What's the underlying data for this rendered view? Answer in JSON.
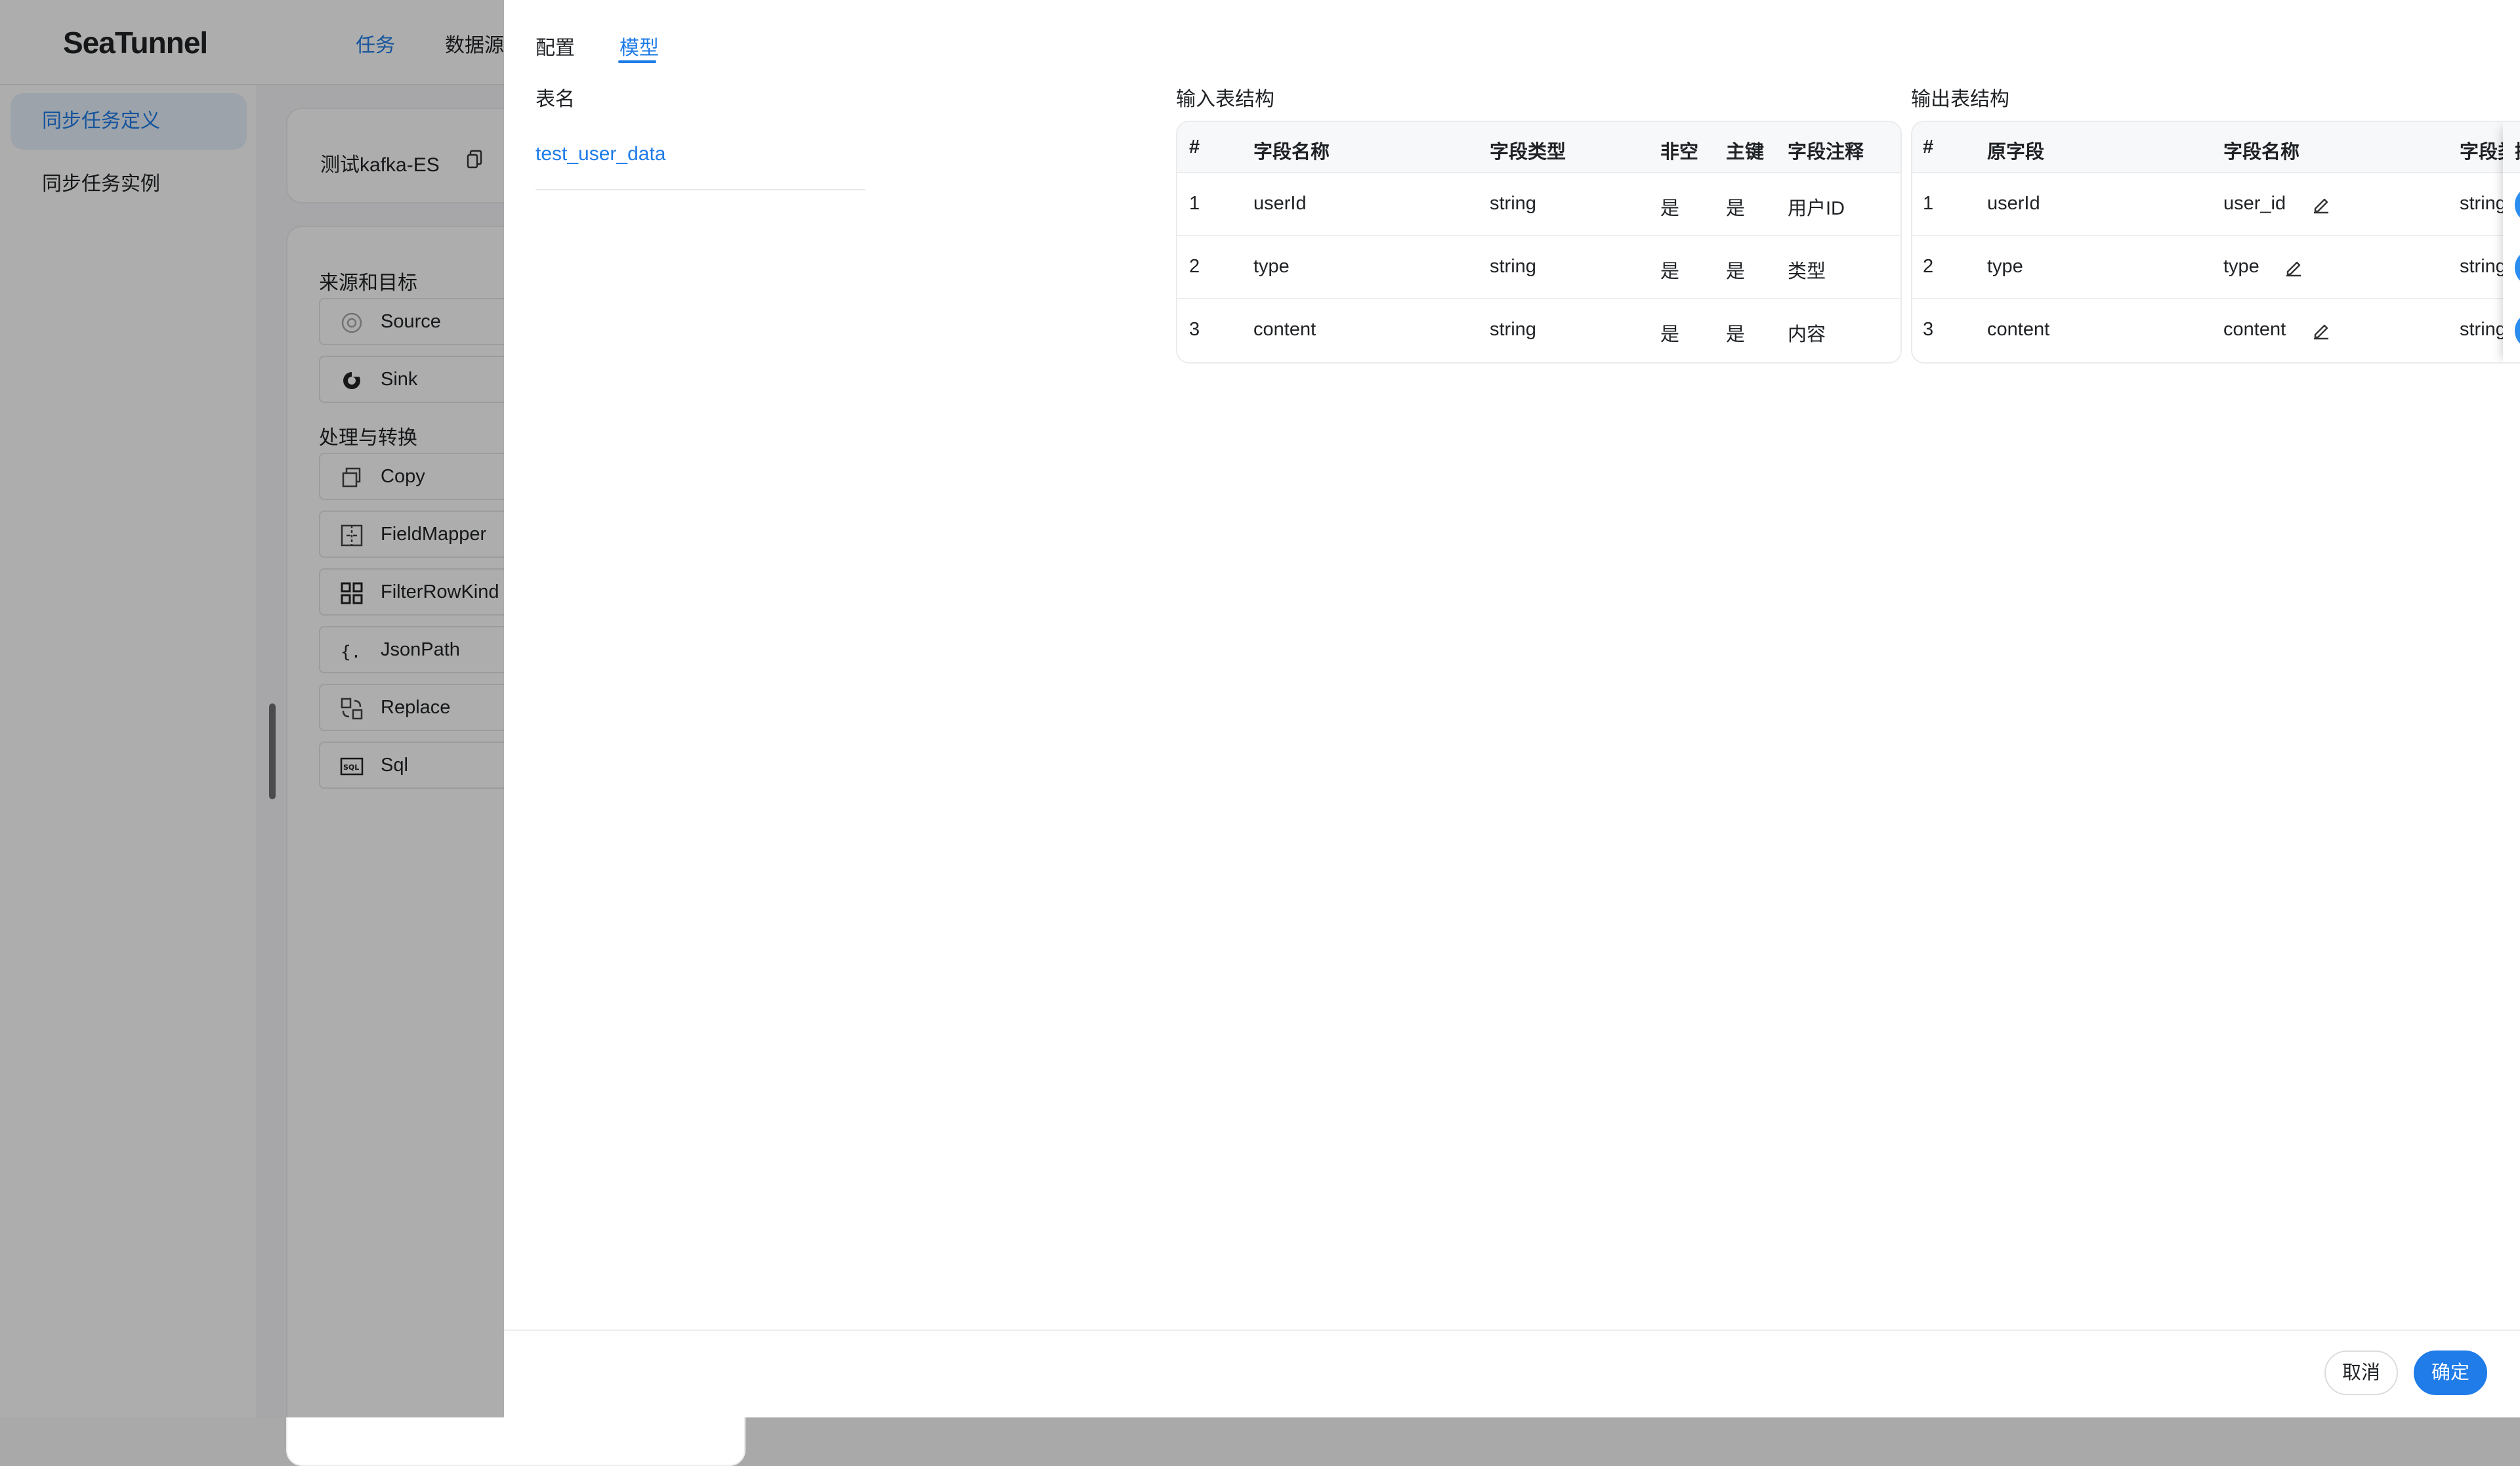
{
  "app": {
    "logo": "SeaTunnel",
    "nav": [
      {
        "label": "任务",
        "active": true
      },
      {
        "label": "数据源",
        "active": false
      }
    ]
  },
  "sidebar": {
    "items": [
      {
        "label": "同步任务定义",
        "active": true
      },
      {
        "label": "同步任务实例",
        "active": false
      }
    ]
  },
  "canvas": {
    "task_name": "测试kafka-ES",
    "section_source_sink": "来源和目标",
    "section_transform": "处理与转换",
    "nodes_source_sink": [
      {
        "label": "Source",
        "icon": "source-icon"
      },
      {
        "label": "Sink",
        "icon": "sink-icon"
      }
    ],
    "nodes_transform": [
      {
        "label": "Copy",
        "icon": "copy-icon"
      },
      {
        "label": "FieldMapper",
        "icon": "field-mapper-icon"
      },
      {
        "label": "FilterRowKind",
        "icon": "grid-icon"
      },
      {
        "label": "JsonPath",
        "icon": "braces-icon"
      },
      {
        "label": "Replace",
        "icon": "replace-icon"
      },
      {
        "label": "Sql",
        "icon": "sql-icon"
      }
    ]
  },
  "drawer": {
    "tabs": [
      {
        "label": "配置",
        "active": false
      },
      {
        "label": "模型",
        "active": true
      }
    ],
    "table_name_label": "表名",
    "table_name": "test_user_data",
    "input_title": "输入表结构",
    "output_title": "输出表结构",
    "input_table": {
      "headers": [
        "#",
        "字段名称",
        "字段类型",
        "非空",
        "主键",
        "字段注释"
      ],
      "rows": [
        [
          "1",
          "userId",
          "string",
          "是",
          "是",
          "用户ID"
        ],
        [
          "2",
          "type",
          "string",
          "是",
          "是",
          "类型"
        ],
        [
          "3",
          "content",
          "string",
          "是",
          "是",
          "内容"
        ]
      ]
    },
    "output_table": {
      "headers": [
        "#",
        "原字段",
        "字段名称",
        "字段类",
        "操作"
      ],
      "rows": [
        [
          "1",
          "userId",
          "user_id",
          "string"
        ],
        [
          "2",
          "type",
          "type",
          "string"
        ],
        [
          "3",
          "content",
          "content",
          "string"
        ]
      ]
    },
    "footer": {
      "cancel": "取消",
      "ok": "确定"
    },
    "colors": {
      "accent": "#1f7ce8",
      "danger": "#f1484b"
    }
  }
}
